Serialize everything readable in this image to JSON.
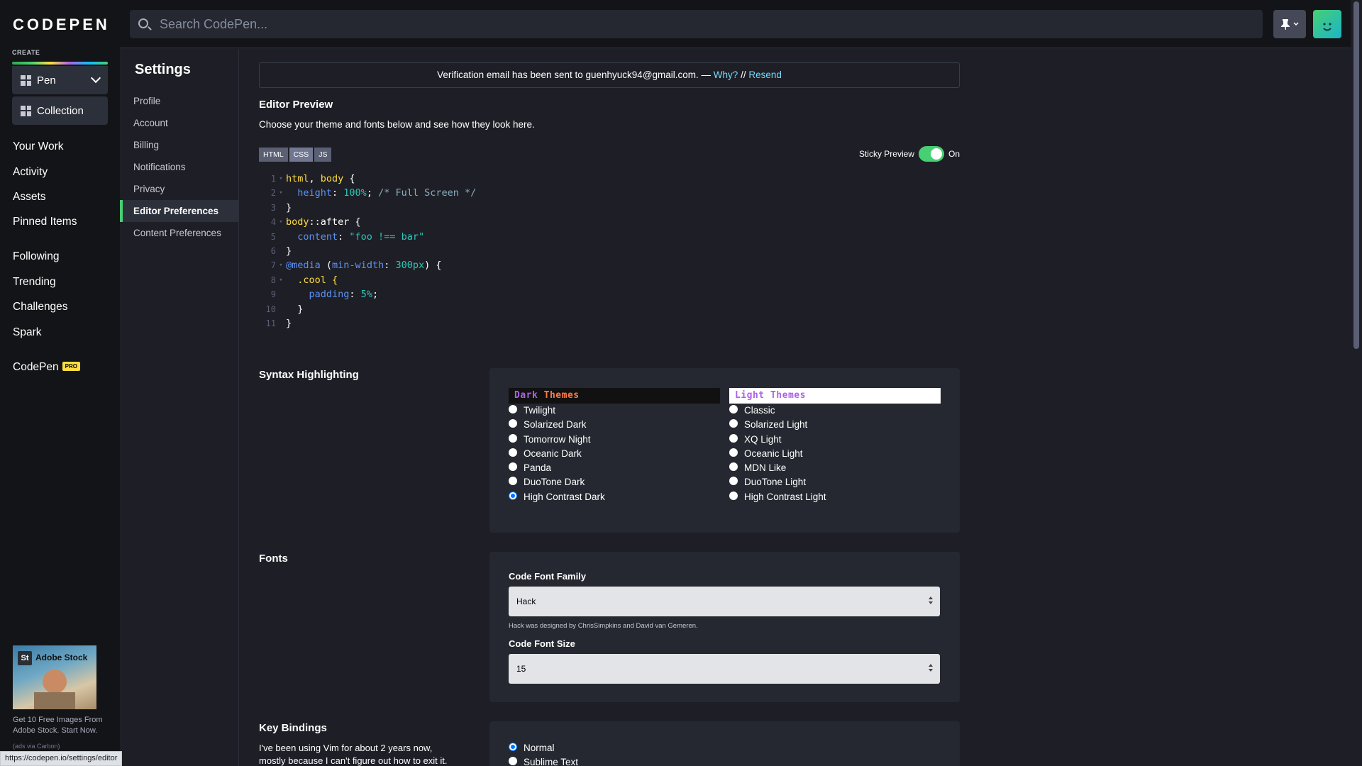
{
  "app": {
    "logo": "CODEPEN",
    "create_label": "CREATE",
    "create_pen": "Pen",
    "create_collection": "Collection"
  },
  "nav": {
    "your_work": "Your Work",
    "activity": "Activity",
    "assets": "Assets",
    "pinned": "Pinned Items",
    "following": "Following",
    "trending": "Trending",
    "challenges": "Challenges",
    "spark": "Spark",
    "codepen": "CodePen",
    "pro": "PRO"
  },
  "ad": {
    "brand": "Adobe Stock",
    "brand_mark": "St",
    "text": "Get 10 Free Images From Adobe Stock. Start Now.",
    "via": "(ads via Carbon)"
  },
  "status_url": "https://codepen.io/settings/editor",
  "search": {
    "placeholder": "Search CodePen..."
  },
  "settings": {
    "title": "Settings",
    "items": [
      "Profile",
      "Account",
      "Billing",
      "Notifications",
      "Privacy",
      "Editor Preferences",
      "Content Preferences"
    ],
    "active": "Editor Preferences"
  },
  "verify": {
    "text": "Verification email has been sent to guenhyuck94@gmail.com. — ",
    "why": "Why?",
    "sep": " // ",
    "resend": "Resend"
  },
  "preview": {
    "title": "Editor Preview",
    "desc": "Choose your theme and fonts below and see how they look here.",
    "tabs": [
      "HTML",
      "CSS",
      "JS"
    ],
    "active_tab": "CSS",
    "sticky_label": "Sticky Preview",
    "sticky_state": "On"
  },
  "code": {
    "lines": [
      "1",
      "2",
      "3",
      "4",
      "5",
      "6",
      "7",
      "8",
      "9",
      "10",
      "11"
    ],
    "tokens": {
      "l1a": "html",
      "l1b": ", ",
      "l1c": "body",
      "l1d": " {",
      "l2a": "  height",
      "l2b": ": ",
      "l2c": "100%",
      "l2d": "; ",
      "l2e": "/* Full Screen */",
      "l3a": "}",
      "l4a": "body",
      "l4b": "::after {",
      "l5a": "  content",
      "l5b": ": ",
      "l5c": "\"foo !== bar\"",
      "l6a": "}",
      "l7a": "@media",
      "l7b": " (",
      "l7c": "min-width",
      "l7d": ": ",
      "l7e": "300px",
      "l7f": ") {",
      "l8a": "  .cool {",
      "l9a": "    padding",
      "l9b": ": ",
      "l9c": "5%",
      "l9d": ";",
      "l10a": "  }",
      "l11a": "}"
    }
  },
  "syntax": {
    "title": "Syntax Highlighting",
    "dark_head_a": "Dark ",
    "dark_head_b": "Themes",
    "light_head": "Light Themes",
    "dark": [
      "Twilight",
      "Solarized Dark",
      "Tomorrow Night",
      "Oceanic Dark",
      "Panda",
      "DuoTone Dark",
      "High Contrast Dark"
    ],
    "light": [
      "Classic",
      "Solarized Light",
      "XQ Light",
      "Oceanic Light",
      "MDN Like",
      "DuoTone Light",
      "High Contrast Light"
    ],
    "selected": "High Contrast Dark"
  },
  "fonts": {
    "title": "Fonts",
    "family_label": "Code Font Family",
    "family_value": "Hack",
    "family_hint": "Hack was designed by ChrisSimpkins and David van Gemeren.",
    "size_label": "Code Font Size",
    "size_value": "15"
  },
  "keys": {
    "title": "Key Bindings",
    "desc_1": "I've been using Vim for about 2 years now,",
    "desc_2": "mostly because I can't figure out how to exit it.",
    "options": [
      "Normal",
      "Sublime Text"
    ],
    "selected": "Normal"
  }
}
